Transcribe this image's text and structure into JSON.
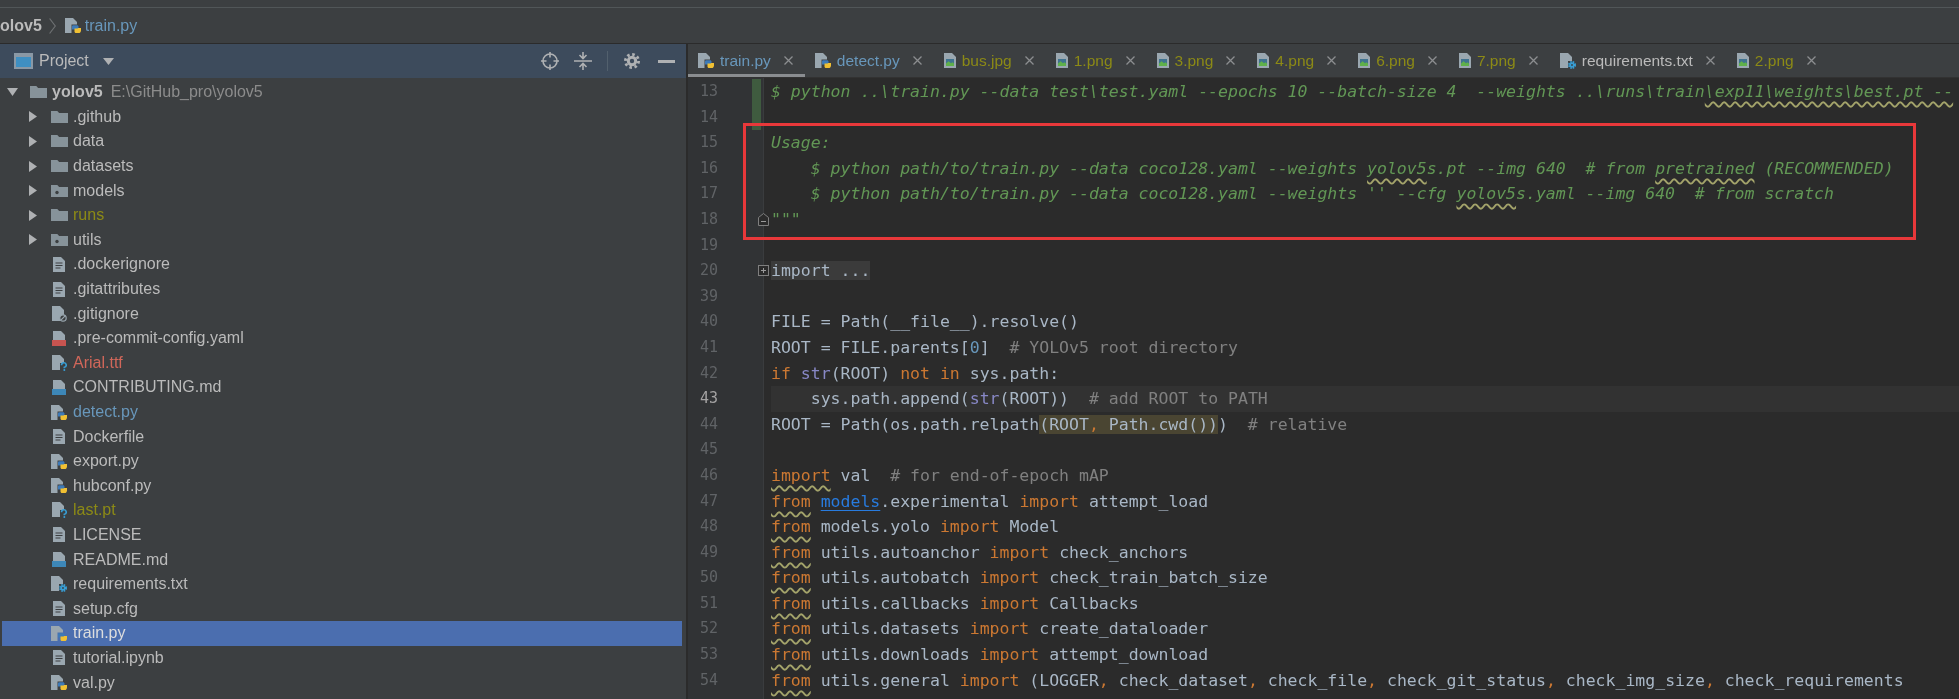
{
  "nav_bar": {
    "crumbs": [
      {
        "label": "olov5",
        "kind": "project",
        "color": "#bbbbbb"
      },
      {
        "label": "train.py",
        "kind": "python",
        "color": "#6897bb"
      }
    ]
  },
  "project_panel": {
    "title": "Project",
    "tree": [
      {
        "name": "yolov5",
        "path": "E:\\GitHub_pro\\yolov5",
        "kind": "folder",
        "expanded": true,
        "selected": false,
        "color": "#bbbbbb",
        "children": [
          {
            "name": ".github",
            "kind": "folder",
            "expanded": false,
            "selected": false,
            "color": "#bbbbbb"
          },
          {
            "name": "data",
            "kind": "folder",
            "expanded": false,
            "selected": false,
            "color": "#bbbbbb"
          },
          {
            "name": "datasets",
            "kind": "folder",
            "expanded": false,
            "selected": false,
            "color": "#bbbbbb"
          },
          {
            "name": "models",
            "kind": "package",
            "expanded": false,
            "selected": false,
            "color": "#bbbbbb"
          },
          {
            "name": "runs",
            "kind": "folder",
            "expanded": false,
            "selected": false,
            "color": "#8c8a16"
          },
          {
            "name": "utils",
            "kind": "package",
            "expanded": false,
            "selected": false,
            "color": "#bbbbbb"
          },
          {
            "name": ".dockerignore",
            "kind": "text",
            "selected": false,
            "color": "#bbbbbb"
          },
          {
            "name": ".gitattributes",
            "kind": "text",
            "selected": false,
            "color": "#bbbbbb"
          },
          {
            "name": ".gitignore",
            "kind": "gitignore",
            "selected": false,
            "color": "#bbbbbb"
          },
          {
            "name": ".pre-commit-config.yaml",
            "kind": "yaml",
            "selected": false,
            "color": "#bbbbbb"
          },
          {
            "name": "Arial.ttf",
            "kind": "unknown",
            "selected": false,
            "color": "#d1675a"
          },
          {
            "name": "CONTRIBUTING.md",
            "kind": "markdown",
            "selected": false,
            "color": "#bbbbbb"
          },
          {
            "name": "detect.py",
            "kind": "python",
            "selected": false,
            "color": "#6897bb"
          },
          {
            "name": "Dockerfile",
            "kind": "text",
            "selected": false,
            "color": "#bbbbbb"
          },
          {
            "name": "export.py",
            "kind": "python",
            "selected": false,
            "color": "#bbbbbb"
          },
          {
            "name": "hubconf.py",
            "kind": "python",
            "selected": false,
            "color": "#bbbbbb"
          },
          {
            "name": "last.pt",
            "kind": "unknown",
            "selected": false,
            "color": "#8c8a16"
          },
          {
            "name": "LICENSE",
            "kind": "text",
            "selected": false,
            "color": "#bbbbbb"
          },
          {
            "name": "README.md",
            "kind": "markdown",
            "selected": false,
            "color": "#bbbbbb"
          },
          {
            "name": "requirements.txt",
            "kind": "requirements",
            "selected": false,
            "color": "#bbbbbb"
          },
          {
            "name": "setup.cfg",
            "kind": "text",
            "selected": false,
            "color": "#bbbbbb"
          },
          {
            "name": "train.py",
            "kind": "python",
            "selected": true,
            "color": "#dddddd"
          },
          {
            "name": "tutorial.ipynb",
            "kind": "text",
            "selected": false,
            "color": "#bbbbbb"
          },
          {
            "name": "val.py",
            "kind": "python",
            "selected": false,
            "color": "#bbbbbb"
          }
        ]
      }
    ]
  },
  "editor": {
    "tabs": [
      {
        "label": "train.py",
        "kind": "python",
        "color": "#6897bb",
        "selected": true
      },
      {
        "label": "detect.py",
        "kind": "python",
        "color": "#6897bb",
        "selected": false
      },
      {
        "label": "bus.jpg",
        "kind": "image",
        "color": "#8c8a16",
        "selected": false
      },
      {
        "label": "1.png",
        "kind": "image",
        "color": "#8c8a16",
        "selected": false
      },
      {
        "label": "3.png",
        "kind": "image",
        "color": "#8c8a16",
        "selected": false
      },
      {
        "label": "4.png",
        "kind": "image",
        "color": "#8c8a16",
        "selected": false
      },
      {
        "label": "6.png",
        "kind": "image",
        "color": "#8c8a16",
        "selected": false
      },
      {
        "label": "7.png",
        "kind": "image",
        "color": "#8c8a16",
        "selected": false
      },
      {
        "label": "requirements.txt",
        "kind": "requirements",
        "color": "#bbbbbb",
        "selected": false
      },
      {
        "label": "2.png",
        "kind": "image",
        "color": "#8c8a16",
        "selected": false
      }
    ],
    "blocks": [
      {
        "framed": false,
        "lines": [
          {
            "number": "13",
            "kind": "code",
            "current": false,
            "changed": true,
            "segments": [
              {
                "text": "$ python ..\\train.py --data test\\test.yaml --epochs 10 --batch-size 4  --weights ..\\runs\\train",
                "kind": "docstring",
                "squiggle": false
              },
              {
                "text": "\\exp11\\weights\\best.pt --",
                "kind": "docstring",
                "squiggle": true
              }
            ]
          },
          {
            "number": "14",
            "kind": "code",
            "current": false,
            "changed": true
          }
        ]
      },
      {
        "framed": true,
        "lines": [
          {
            "number": "15",
            "kind": "code",
            "current": false,
            "changed": false,
            "segments": [
              {
                "text": "Usage:",
                "kind": "docstring",
                "squiggle": false
              }
            ]
          },
          {
            "number": "16",
            "kind": "code",
            "current": false,
            "changed": false,
            "segments": [
              {
                "text": "    $ python path/to/train.py --data coco128.yaml --weights ",
                "kind": "docstring",
                "squiggle": false
              },
              {
                "text": "yolov5",
                "kind": "docstring",
                "squiggle": true
              },
              {
                "text": "s.pt --img 640  # from ",
                "kind": "docstring",
                "squiggle": false
              },
              {
                "text": "pretrained",
                "kind": "docstring",
                "squiggle": true
              },
              {
                "text": " (RECOMMENDED)",
                "kind": "docstring",
                "squiggle": false
              }
            ]
          },
          {
            "number": "17",
            "kind": "code",
            "current": false,
            "changed": false,
            "segments": [
              {
                "text": "    $ python path/to/train.py --data coco128.yaml --weights '' --cfg ",
                "kind": "docstring",
                "squiggle": false
              },
              {
                "text": "yolov5",
                "kind": "docstring",
                "squiggle": true
              },
              {
                "text": "s.yaml --img 640  # from scratch",
                "kind": "docstring",
                "squiggle": false
              }
            ]
          },
          {
            "number": "18",
            "kind": "fold_end",
            "current": false,
            "changed": false,
            "segments": [
              {
                "text": "\"\"\"",
                "kind": "docstring",
                "squiggle": false
              }
            ]
          }
        ]
      },
      {
        "framed": false,
        "lines": [
          {
            "number": "19",
            "kind": "code",
            "current": false,
            "changed": false
          },
          {
            "number": "20",
            "kind": "folded",
            "current": false,
            "changed": false,
            "segments": [
              {
                "text": "import ...",
                "kind": "folded",
                "squiggle": false
              }
            ]
          },
          {
            "number": "39",
            "kind": "code",
            "current": false,
            "changed": false
          },
          {
            "number": "40",
            "kind": "code",
            "current": false,
            "changed": false,
            "segments": [
              {
                "text": "FILE = Path(__file__).resolve()",
                "kind": "plain",
                "squiggle": false
              }
            ]
          },
          {
            "number": "41",
            "kind": "code",
            "current": false,
            "changed": false,
            "segments": [
              {
                "text": "ROOT = FILE.parents[",
                "kind": "plain",
                "squiggle": false
              },
              {
                "text": "0",
                "kind": "number",
                "squiggle": false
              },
              {
                "text": "]",
                "kind": "plain",
                "squiggle": false
              },
              {
                "text": "  # YOLOv5 root directory",
                "kind": "comment",
                "squiggle": false
              }
            ]
          },
          {
            "number": "42",
            "kind": "code",
            "current": false,
            "changed": false,
            "segments": [
              {
                "text": "if ",
                "kind": "keyword",
                "squiggle": false
              },
              {
                "text": "str",
                "kind": "builtin",
                "squiggle": false
              },
              {
                "text": "(ROOT) ",
                "kind": "plain",
                "squiggle": false
              },
              {
                "text": "not in",
                "kind": "keyword",
                "squiggle": false
              },
              {
                "text": " sys.path:",
                "kind": "plain",
                "squiggle": false
              }
            ]
          },
          {
            "number": "43",
            "kind": "code",
            "current": true,
            "changed": false,
            "segments": [
              {
                "text": "    sys.path.append(",
                "kind": "plain",
                "squiggle": false
              },
              {
                "text": "str",
                "kind": "builtin",
                "squiggle": false
              },
              {
                "text": "(ROOT))",
                "kind": "plain",
                "squiggle": false
              },
              {
                "text": "  # add ROOT to PATH",
                "kind": "comment",
                "squiggle": false
              }
            ]
          },
          {
            "number": "44",
            "kind": "code",
            "current": false,
            "changed": false,
            "segments": [
              {
                "text": "ROOT = Path(os.path.relpath",
                "kind": "plain",
                "squiggle": false
              },
              {
                "text": "(ROOT",
                "kind": "match",
                "squiggle": false
              },
              {
                "text": ",",
                "kind": "match_comma",
                "squiggle": false
              },
              {
                "text": " Path.cwd())",
                "kind": "match",
                "squiggle": false
              },
              {
                "text": ")",
                "kind": "plain",
                "squiggle": false
              },
              {
                "text": "  # relative",
                "kind": "comment",
                "squiggle": false
              }
            ]
          },
          {
            "number": "45",
            "kind": "code",
            "current": false,
            "changed": false
          },
          {
            "number": "46",
            "kind": "code",
            "current": false,
            "changed": false,
            "segments": [
              {
                "text": "import",
                "kind": "keyword",
                "squiggle": true
              },
              {
                "text": " val  ",
                "kind": "plain",
                "squiggle": false
              },
              {
                "text": "# for end-of-epoch mAP",
                "kind": "comment",
                "squiggle": false
              }
            ]
          },
          {
            "number": "47",
            "kind": "code",
            "current": false,
            "changed": false,
            "segments": [
              {
                "text": "from ",
                "kind": "keyword",
                "squiggle": true
              },
              {
                "text": "models",
                "kind": "link",
                "squiggle": false
              },
              {
                "text": ".experimental ",
                "kind": "plain",
                "squiggle": false
              },
              {
                "text": "import",
                "kind": "keyword",
                "squiggle": false
              },
              {
                "text": " attempt_load",
                "kind": "plain",
                "squiggle": false
              }
            ]
          },
          {
            "number": "48",
            "kind": "code",
            "current": false,
            "changed": false,
            "segments": [
              {
                "text": "from",
                "kind": "keyword",
                "squiggle": true
              },
              {
                "text": " models.yolo ",
                "kind": "plain",
                "squiggle": false
              },
              {
                "text": "import",
                "kind": "keyword",
                "squiggle": false
              },
              {
                "text": " Model",
                "kind": "plain",
                "squiggle": false
              }
            ]
          },
          {
            "number": "49",
            "kind": "code",
            "current": false,
            "changed": false,
            "segments": [
              {
                "text": "from",
                "kind": "keyword",
                "squiggle": true
              },
              {
                "text": " utils.autoanchor ",
                "kind": "plain",
                "squiggle": false
              },
              {
                "text": "import",
                "kind": "keyword",
                "squiggle": false
              },
              {
                "text": " check_anchors",
                "kind": "plain",
                "squiggle": false
              }
            ]
          },
          {
            "number": "50",
            "kind": "code",
            "current": false,
            "changed": false,
            "segments": [
              {
                "text": "from",
                "kind": "keyword",
                "squiggle": true
              },
              {
                "text": " utils.autobatch ",
                "kind": "plain",
                "squiggle": false
              },
              {
                "text": "import",
                "kind": "keyword",
                "squiggle": false
              },
              {
                "text": " check_train_batch_size",
                "kind": "plain",
                "squiggle": false
              }
            ]
          },
          {
            "number": "51",
            "kind": "code",
            "current": false,
            "changed": false,
            "segments": [
              {
                "text": "from",
                "kind": "keyword",
                "squiggle": true
              },
              {
                "text": " utils.callbacks ",
                "kind": "plain",
                "squiggle": false
              },
              {
                "text": "import",
                "kind": "keyword",
                "squiggle": false
              },
              {
                "text": " Callbacks",
                "kind": "plain",
                "squiggle": false
              }
            ]
          },
          {
            "number": "52",
            "kind": "code",
            "current": false,
            "changed": false,
            "segments": [
              {
                "text": "from",
                "kind": "keyword",
                "squiggle": true
              },
              {
                "text": " utils.datasets ",
                "kind": "plain",
                "squiggle": false
              },
              {
                "text": "import",
                "kind": "keyword",
                "squiggle": false
              },
              {
                "text": " create_dataloader",
                "kind": "plain",
                "squiggle": false
              }
            ]
          },
          {
            "number": "53",
            "kind": "code",
            "current": false,
            "changed": false,
            "segments": [
              {
                "text": "from",
                "kind": "keyword",
                "squiggle": true
              },
              {
                "text": " utils.downloads ",
                "kind": "plain",
                "squiggle": false
              },
              {
                "text": "import",
                "kind": "keyword",
                "squiggle": false
              },
              {
                "text": " attempt_download",
                "kind": "plain",
                "squiggle": false
              }
            ]
          },
          {
            "number": "54",
            "kind": "code",
            "current": false,
            "changed": false,
            "segments": [
              {
                "text": "from",
                "kind": "keyword",
                "squiggle": true
              },
              {
                "text": " utils.general ",
                "kind": "plain",
                "squiggle": false
              },
              {
                "text": "import",
                "kind": "keyword",
                "squiggle": false
              },
              {
                "text": " (LOGGER",
                "kind": "plain",
                "squiggle": false
              },
              {
                "text": ",",
                "kind": "keyword",
                "squiggle": false
              },
              {
                "text": " check_dataset",
                "kind": "plain",
                "squiggle": false
              },
              {
                "text": ",",
                "kind": "keyword",
                "squiggle": false
              },
              {
                "text": " check_file",
                "kind": "plain",
                "squiggle": false
              },
              {
                "text": ",",
                "kind": "keyword",
                "squiggle": false
              },
              {
                "text": " check_git_status",
                "kind": "plain",
                "squiggle": false
              },
              {
                "text": ",",
                "kind": "keyword",
                "squiggle": false
              },
              {
                "text": " check_img_size",
                "kind": "plain",
                "squiggle": false
              },
              {
                "text": ",",
                "kind": "keyword",
                "squiggle": false
              },
              {
                "text": " check_requirements",
                "kind": "plain",
                "squiggle": false
              }
            ]
          }
        ]
      }
    ]
  }
}
